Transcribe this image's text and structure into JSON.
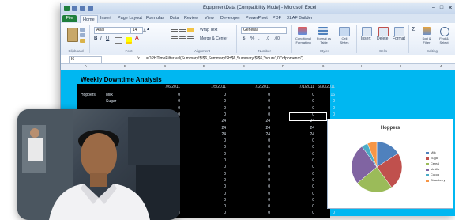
{
  "window": {
    "title": "EquipmentData [Compatibility Mode] - Microsoft Excel"
  },
  "tabs": [
    "File",
    "Home",
    "Insert",
    "Page Layout",
    "Formulas",
    "Data",
    "Review",
    "View",
    "Developer",
    "PowerPivot",
    "PDF",
    "XLAF Builder"
  ],
  "ribbon": {
    "font_name": "Arial",
    "font_size": "14",
    "number_format": "General",
    "wrap_text": "Wrap Text",
    "merge_center": "Merge & Center",
    "conditional_formatting": "Conditional Formatting",
    "format_as_table": "Format as Table",
    "cell_styles": "Cell Styles",
    "insert": "Insert",
    "delete": "Delete",
    "format": "Format",
    "sort_filter": "Sort & Filter",
    "find_select": "Find & Select",
    "groups": [
      "Clipboard",
      "Font",
      "Alignment",
      "Number",
      "Styles",
      "Cells",
      "Editing"
    ]
  },
  "formula_bar": {
    "name_box": "I6",
    "fx": "fx",
    "formula": "=DPHTimeFilter.val(Summary!$I$6,Summary!$H$6,Summary!$I$6,\"hours\",0,\"dfpomenm\")"
  },
  "sheet": {
    "title": "Weekly Downtime Analysis",
    "dates": [
      "7/6/2011",
      "7/5/2011",
      "7/2/2011",
      "7/1/2011",
      "6/30/2011"
    ],
    "rows": [
      {
        "name": "Hoppers",
        "sub": "Milk",
        "values": [
          "0",
          "0",
          "0",
          "0",
          "16"
        ]
      },
      {
        "name": "",
        "sub": "Sugar",
        "values": [
          "0",
          "0",
          "0",
          "0",
          "0"
        ]
      },
      {
        "name": "",
        "sub": "",
        "values": [
          "0",
          "0",
          "0",
          "0",
          "0"
        ]
      },
      {
        "name": "",
        "sub": "",
        "values": [
          "0",
          "0",
          "0",
          "0",
          "0"
        ]
      },
      {
        "name": "",
        "sub": "",
        "values": [
          "24",
          "24",
          "24",
          "24",
          "24"
        ]
      },
      {
        "name": "",
        "sub": "",
        "values": [
          "24",
          "24",
          "24",
          "24",
          "24"
        ]
      },
      {
        "name": "",
        "sub": "",
        "values": [
          "24",
          "24",
          "24",
          "24",
          "26"
        ]
      },
      {
        "name": "",
        "sub": "",
        "values": [
          "0",
          "0",
          "0",
          "0",
          "0"
        ]
      },
      {
        "name": "",
        "sub": "",
        "values": [
          "0",
          "0",
          "0",
          "0",
          "0"
        ]
      },
      {
        "name": "",
        "sub": "",
        "values": [
          "0",
          "0",
          "0",
          "0",
          "0"
        ]
      },
      {
        "name": "",
        "sub": "",
        "values": [
          "0",
          "0",
          "0",
          "0",
          "0"
        ]
      },
      {
        "name": "",
        "sub": "",
        "values": [
          "0",
          "0",
          "0",
          "0",
          "0"
        ]
      },
      {
        "name": "",
        "sub": "",
        "values": [
          "0",
          "0",
          "0",
          "0",
          "0"
        ]
      },
      {
        "name": "",
        "sub": "",
        "values": [
          "0",
          "0",
          "0",
          "0",
          "0"
        ]
      },
      {
        "name": "",
        "sub": "",
        "values": [
          "0",
          "0",
          "0",
          "0",
          "0"
        ]
      },
      {
        "name": "",
        "sub": "",
        "values": [
          "0",
          "0",
          "0",
          "0",
          "0"
        ]
      },
      {
        "name": "",
        "sub": "",
        "values": [
          "0",
          "0",
          "0",
          "0",
          "0"
        ]
      },
      {
        "name": "",
        "sub": "",
        "values": [
          "0",
          "0",
          "0",
          "0",
          "0"
        ]
      },
      {
        "name": "",
        "sub": "",
        "values": [
          "0",
          "0",
          "0",
          "0",
          "0"
        ]
      }
    ]
  },
  "chart_data": {
    "type": "pie",
    "title": "Hoppers",
    "categories": [
      "Milk",
      "Sugar",
      "Cereal",
      "Vanilla",
      "Cocoa",
      "Strawberry"
    ],
    "values": [
      16,
      24,
      24,
      26,
      4,
      6
    ],
    "colors": [
      "#4f81bd",
      "#c0504d",
      "#9bbb59",
      "#8064a2",
      "#4bacc6",
      "#f79646"
    ]
  },
  "colors": {
    "sheet_bg": "#00b7f1",
    "table_bg": "#000000",
    "file_tab": "#1e7f3d"
  }
}
